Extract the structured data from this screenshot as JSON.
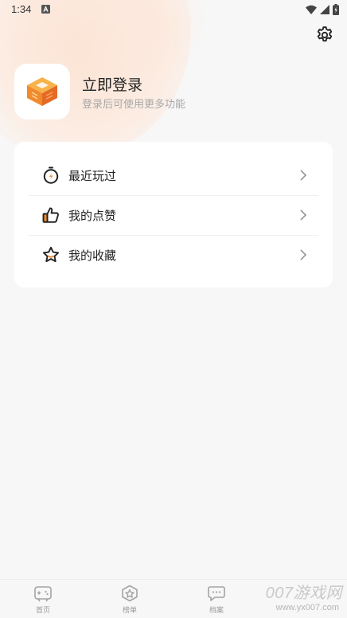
{
  "status_bar": {
    "time": "1:34"
  },
  "profile": {
    "title": "立即登录",
    "subtitle": "登录后可使用更多功能"
  },
  "menu": {
    "items": [
      {
        "label": "最近玩过",
        "icon": "timer-icon"
      },
      {
        "label": "我的点赞",
        "icon": "thumbs-up-icon"
      },
      {
        "label": "我的收藏",
        "icon": "star-icon"
      }
    ]
  },
  "tabs": [
    {
      "label": "首页",
      "icon": "gamepad-icon"
    },
    {
      "label": "榜单",
      "icon": "ranking-star-icon"
    },
    {
      "label": "档案",
      "icon": "chat-bubble-icon"
    }
  ],
  "watermark": {
    "text": "007游戏网",
    "sub": "www.yx007.com"
  },
  "colors": {
    "accent": "#f08a2c",
    "background": "#f7f7f7",
    "card": "#ffffff"
  }
}
